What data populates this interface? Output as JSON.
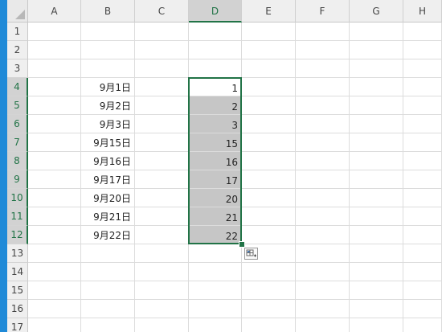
{
  "columns": [
    "A",
    "B",
    "C",
    "D",
    "E",
    "F",
    "G",
    "H"
  ],
  "selected_column": "D",
  "rows": [
    "1",
    "2",
    "3",
    "4",
    "5",
    "6",
    "7",
    "8",
    "9",
    "10",
    "11",
    "12",
    "13",
    "14",
    "15",
    "16",
    "17"
  ],
  "selected_rows": [
    "4",
    "5",
    "6",
    "7",
    "8",
    "9",
    "10",
    "11",
    "12"
  ],
  "cells": [
    {
      "row": "4",
      "col": "B",
      "value": "9月1日"
    },
    {
      "row": "5",
      "col": "B",
      "value": "9月2日"
    },
    {
      "row": "6",
      "col": "B",
      "value": "9月3日"
    },
    {
      "row": "7",
      "col": "B",
      "value": "9月15日"
    },
    {
      "row": "8",
      "col": "B",
      "value": "9月16日"
    },
    {
      "row": "9",
      "col": "B",
      "value": "9月17日"
    },
    {
      "row": "10",
      "col": "B",
      "value": "9月20日"
    },
    {
      "row": "11",
      "col": "B",
      "value": "9月21日"
    },
    {
      "row": "12",
      "col": "B",
      "value": "9月22日"
    },
    {
      "row": "4",
      "col": "D",
      "value": "1"
    },
    {
      "row": "5",
      "col": "D",
      "value": "2"
    },
    {
      "row": "6",
      "col": "D",
      "value": "3"
    },
    {
      "row": "7",
      "col": "D",
      "value": "15"
    },
    {
      "row": "8",
      "col": "D",
      "value": "16"
    },
    {
      "row": "9",
      "col": "D",
      "value": "17"
    },
    {
      "row": "10",
      "col": "D",
      "value": "20"
    },
    {
      "row": "11",
      "col": "D",
      "value": "21"
    },
    {
      "row": "12",
      "col": "D",
      "value": "22"
    }
  ],
  "selection": {
    "range": "D4:D12",
    "active_cell": "D4"
  },
  "icons": {
    "corner": "select-all-triangle-icon",
    "quick_analysis": "quick-analysis-icon",
    "fill_handle": "fill-handle"
  },
  "colors": {
    "accent": "#217346",
    "selection_fill": "#c6c6c6",
    "header_bg": "#efefef",
    "left_strip": "#1f8ad8"
  }
}
